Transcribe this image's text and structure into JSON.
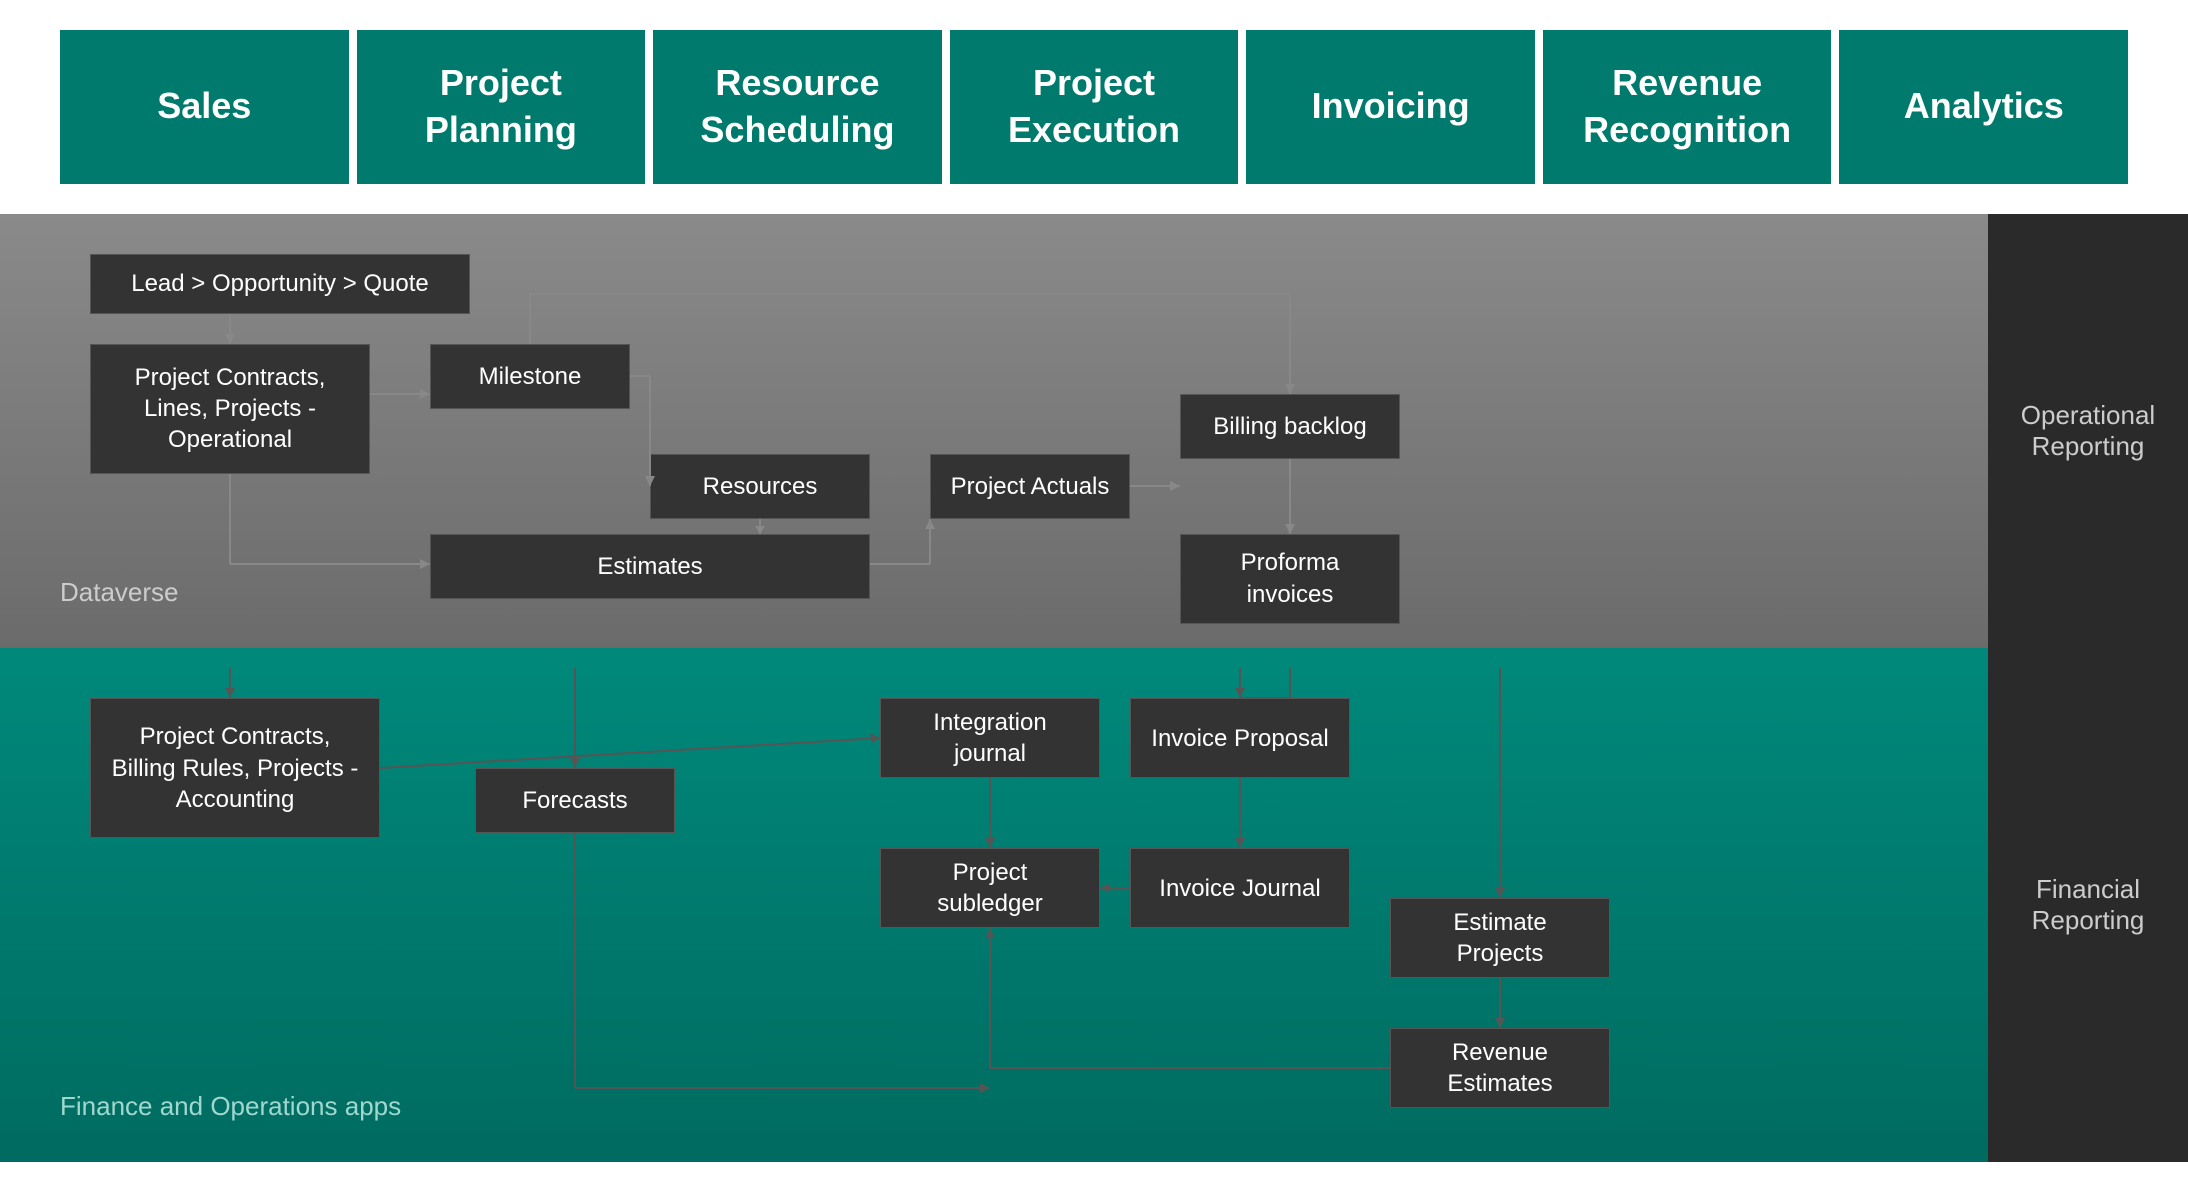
{
  "header": {
    "tiles": [
      {
        "id": "sales",
        "label": "Sales"
      },
      {
        "id": "project-planning",
        "label": "Project Planning"
      },
      {
        "id": "resource-scheduling",
        "label": "Resource Scheduling"
      },
      {
        "id": "project-execution",
        "label": "Project Execution"
      },
      {
        "id": "invoicing",
        "label": "Invoicing"
      },
      {
        "id": "revenue-recognition",
        "label": "Revenue Recognition"
      },
      {
        "id": "analytics",
        "label": "Analytics"
      }
    ]
  },
  "dataverse": {
    "label": "Dataverse",
    "right_label": "Operational\nReporting",
    "boxes": {
      "lead_opportunity_quote": "Lead > Opportunity > Quote",
      "project_contracts_operational": "Project Contracts, Lines, Projects - Operational",
      "milestone": "Milestone",
      "resources": "Resources",
      "estimates": "Estimates",
      "project_actuals": "Project Actuals",
      "billing_backlog": "Billing backlog",
      "proforma_invoices": "Proforma invoices"
    }
  },
  "finance": {
    "label": "Finance and Operations apps",
    "right_label": "Financial\nReporting",
    "boxes": {
      "project_contracts_accounting": "Project Contracts, Billing Rules, Projects - Accounting",
      "forecasts": "Forecasts",
      "integration_journal": "Integration journal",
      "invoice_proposal": "Invoice Proposal",
      "project_subledger": "Project subledger",
      "invoice_journal": "Invoice Journal",
      "estimate_projects": "Estimate Projects",
      "revenue_estimates": "Revenue Estimates"
    }
  }
}
